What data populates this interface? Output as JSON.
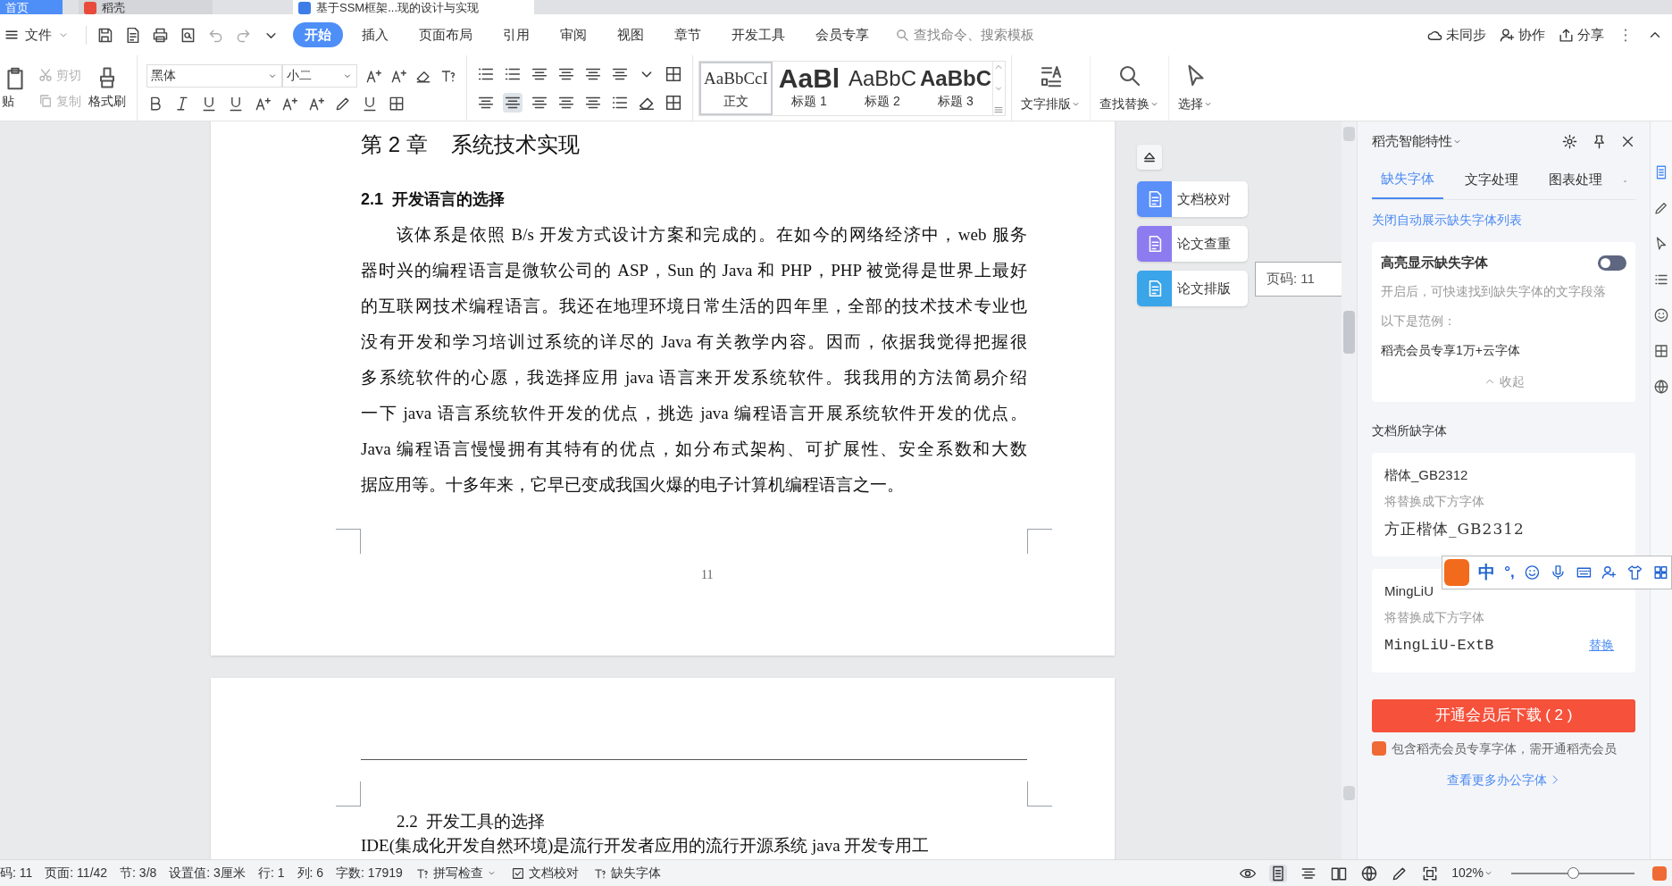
{
  "window_tabs": [
    {
      "label": "首页",
      "kind": "home",
      "selected": false
    },
    {
      "label": "稻壳",
      "kind": "docer",
      "selected": false
    },
    {
      "label": "基于SSM框架...现的设计与实现",
      "kind": "doc",
      "selected": true
    }
  ],
  "menu": {
    "file": "文件",
    "tabs": [
      {
        "label": "开始",
        "selected": true
      },
      {
        "label": "插入",
        "selected": false
      },
      {
        "label": "页面布局",
        "selected": false
      },
      {
        "label": "引用",
        "selected": false
      },
      {
        "label": "审阅",
        "selected": false
      },
      {
        "label": "视图",
        "selected": false
      },
      {
        "label": "章节",
        "selected": false
      },
      {
        "label": "开发工具",
        "selected": false
      },
      {
        "label": "会员专享",
        "selected": false
      }
    ],
    "search": {
      "placeholder": "查找命令、搜索模板"
    },
    "actions": [
      {
        "label": "未同步",
        "kind": "cloud"
      },
      {
        "label": "协作",
        "kind": "user"
      },
      {
        "label": "分享",
        "kind": "share"
      }
    ]
  },
  "ribbon": {
    "paste": "贴",
    "cut": {
      "label": "剪切",
      "disabled": true
    },
    "copy": {
      "label": "复制",
      "disabled": true
    },
    "format_painter": "格式刷",
    "font": "黑体",
    "size": "小二",
    "styles": [
      {
        "sample": "AaBbCcI",
        "label": "正文",
        "kind": "body",
        "selected": true
      },
      {
        "sample": "AaBl",
        "label": "标题 1",
        "kind": "h1",
        "selected": false
      },
      {
        "sample": "AaBbC",
        "label": "标题 2",
        "kind": "h2",
        "selected": false
      },
      {
        "sample": "AaBbC",
        "label": "标题 3",
        "kind": "h3",
        "selected": false
      }
    ],
    "tools": [
      {
        "label": "文字排版",
        "kind": "layout"
      },
      {
        "label": "查找替换",
        "kind": "find"
      },
      {
        "label": "选择",
        "kind": "select"
      }
    ]
  },
  "document": {
    "page1": {
      "chapter": "第 2 章    系统技术实现",
      "section": "2.1  开发语言的选择",
      "paragraph": [
        "该体系是依照 B/s 开发方式设计方案和完成的。在如今的网络经济中，web 服务",
        "器时兴的编程语言是微软公司的 ASP，Sun 的 Java 和 PHP，PHP 被觉得是世界上最好",
        "的互联网技术编程语言。我还在地理环境日常生活的四年里，全部的技术技术专业也",
        "没有开发和学习培训过系统的详尽的 Java 有关教学内容。因而，依据我觉得把握很",
        "多系统软件的心愿，我选择应用 java 语言来开发系统软件。我我用的方法简易介绍",
        "一下 java 语言系统软件开发的优点，挑选 java 编程语言开展系统软件开发的优点。",
        "Java 编程语言慢慢拥有其特有的优点，如分布式架构、可扩展性、安全系数和大数",
        "据应用等。十多年来，它早已变成我国火爆的电子计算机编程语言之一。"
      ],
      "page_number": "11"
    },
    "page2": {
      "section": "2.2  开发工具的选择",
      "line": "IDE(集成化开发自然环境)是流行开发者应用的流行开源系统 java 开发专用工"
    }
  },
  "float_tools": [
    {
      "label": "文档校对",
      "color": "#5b8ff9"
    },
    {
      "label": "论文查重",
      "color": "#8c7cf0"
    },
    {
      "label": "论文排版",
      "color": "#3aa5e8"
    }
  ],
  "page_tooltip": "页码: 11",
  "panel": {
    "title": "稻壳智能特性",
    "tabs": [
      {
        "label": "缺失字体",
        "selected": true
      },
      {
        "label": "文字处理",
        "selected": false
      },
      {
        "label": "图表处理",
        "selected": false
      }
    ],
    "close_link": "关闭自动展示缺失字体列表",
    "highlight": {
      "label": "高亮显示缺失字体",
      "on": false,
      "description": "开启后，可快速找到缺失字体的文字段落",
      "example_label": "以下是范例：",
      "example": "稻壳会员专享1万+云字体",
      "collapse": "收起"
    },
    "missing_title": "文档所缺字体",
    "fonts": [
      {
        "name": "楷体_GB2312",
        "note": "将替换成下方字体",
        "replacement": "方正楷体_GB2312",
        "kind": "kai"
      },
      {
        "name": "MingLiU",
        "note": "将替换成下方字体",
        "replacement": "MingLiU-ExtB",
        "kind": "mono",
        "action": "替换"
      }
    ],
    "download_button": "开通会员后下载 ( 2 )",
    "member_note": "包含稻壳会员专享字体，需开通稻壳会员",
    "more_link": "查看更多办公字体"
  },
  "ime_bar": {
    "mode": "中",
    "punctuation": "°,"
  },
  "status_bar": {
    "items": [
      "码: 11",
      "页面: 11/42",
      "节: 3/8",
      "设置值: 3厘米",
      "行: 1",
      "列: 6",
      "字数: 17919"
    ],
    "spell_check": "拼写检查",
    "proof": "文档校对",
    "missing_font": "缺失字体",
    "zoom": "102%",
    "zoom_slider": {
      "level": 0.5
    }
  }
}
